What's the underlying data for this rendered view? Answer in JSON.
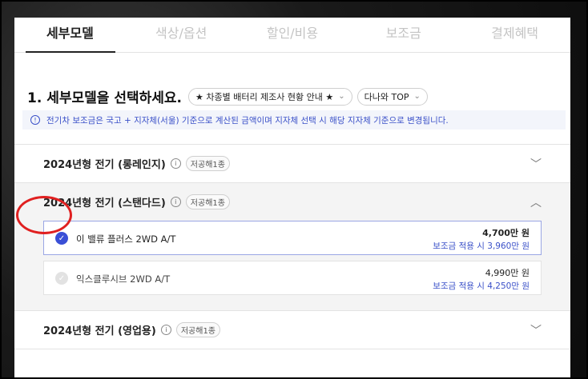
{
  "tabs": [
    {
      "label": "세부모델"
    },
    {
      "label": "색상/옵션"
    },
    {
      "label": "할인/비용"
    },
    {
      "label": "보조금"
    },
    {
      "label": "결제혜택"
    }
  ],
  "heading": "1. 세부모델을 선택하세요.",
  "pills": {
    "battery": "★ 차종별 배터리 제조사 현황 안내 ★",
    "top": "다나와 TOP"
  },
  "notice": "전기차 보조금은 국고 + 지자체(서울) 기준으로 계산된 금액이며 지자체 선택 시 해당 지자체 기준으로 변경됩니다.",
  "groups": [
    {
      "title": "2024년형 전기 (롱레인지)",
      "tag": "저공해1종"
    },
    {
      "title": "2024년형 전기 (스탠다드)",
      "tag": "저공해1종"
    },
    {
      "title": "2024년형 전기 (영업용)",
      "tag": "저공해1종"
    }
  ],
  "options": [
    {
      "name": "이 밸류 플러스 2WD A/T",
      "price": "4,700만 원",
      "subsidy": "보조금 적용 시 3,960만 원",
      "selected": true
    },
    {
      "name": "익스클루시브 2WD A/T",
      "price": "4,990만 원",
      "subsidy": "보조금 적용 시 4,250만 원",
      "selected": false
    }
  ],
  "colors": {
    "accent": "#3a4fd6",
    "annotation": "#e02020"
  },
  "icons": {
    "info": "info-icon",
    "chevron": "chevron-icon",
    "check": "check-icon"
  }
}
